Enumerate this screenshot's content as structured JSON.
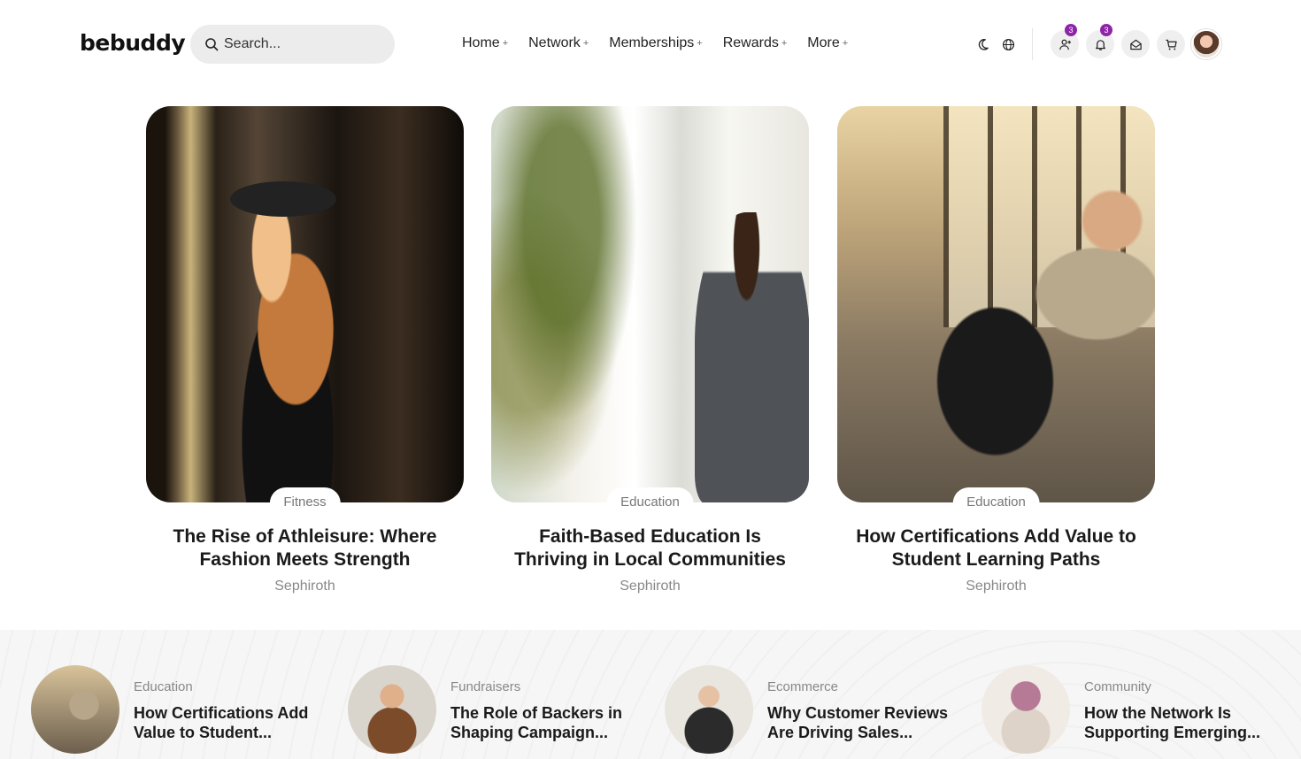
{
  "header": {
    "logo": "bebuddy",
    "search_placeholder": "Search...",
    "nav": [
      {
        "label": "Home"
      },
      {
        "label": "Network"
      },
      {
        "label": "Memberships"
      },
      {
        "label": "Rewards"
      },
      {
        "label": "More"
      }
    ],
    "friend_requests_count": "3",
    "notifications_count": "3"
  },
  "featured": [
    {
      "category": "Fitness",
      "title": "The Rise of Athleisure: Where Fashion Meets Strength",
      "author": "Sephiroth"
    },
    {
      "category": "Education",
      "title": "Faith-Based Education Is Thriving in Local Communities",
      "author": "Sephiroth"
    },
    {
      "category": "Education",
      "title": "How Certifications Add Value to Student Learning Paths",
      "author": "Sephiroth"
    }
  ],
  "strip": [
    {
      "category": "Education",
      "title": "How Certifications Add Value to Student..."
    },
    {
      "category": "Fundraisers",
      "title": "The Role of Backers in Shaping Campaign..."
    },
    {
      "category": "Ecommerce",
      "title": "Why Customer Reviews Are Driving Sales..."
    },
    {
      "category": "Community",
      "title": "How the Network Is Supporting Emerging..."
    }
  ],
  "colors": {
    "badge": "#8e24aa",
    "search_bg": "#ececec",
    "strip_bg": "#f6f6f6"
  }
}
